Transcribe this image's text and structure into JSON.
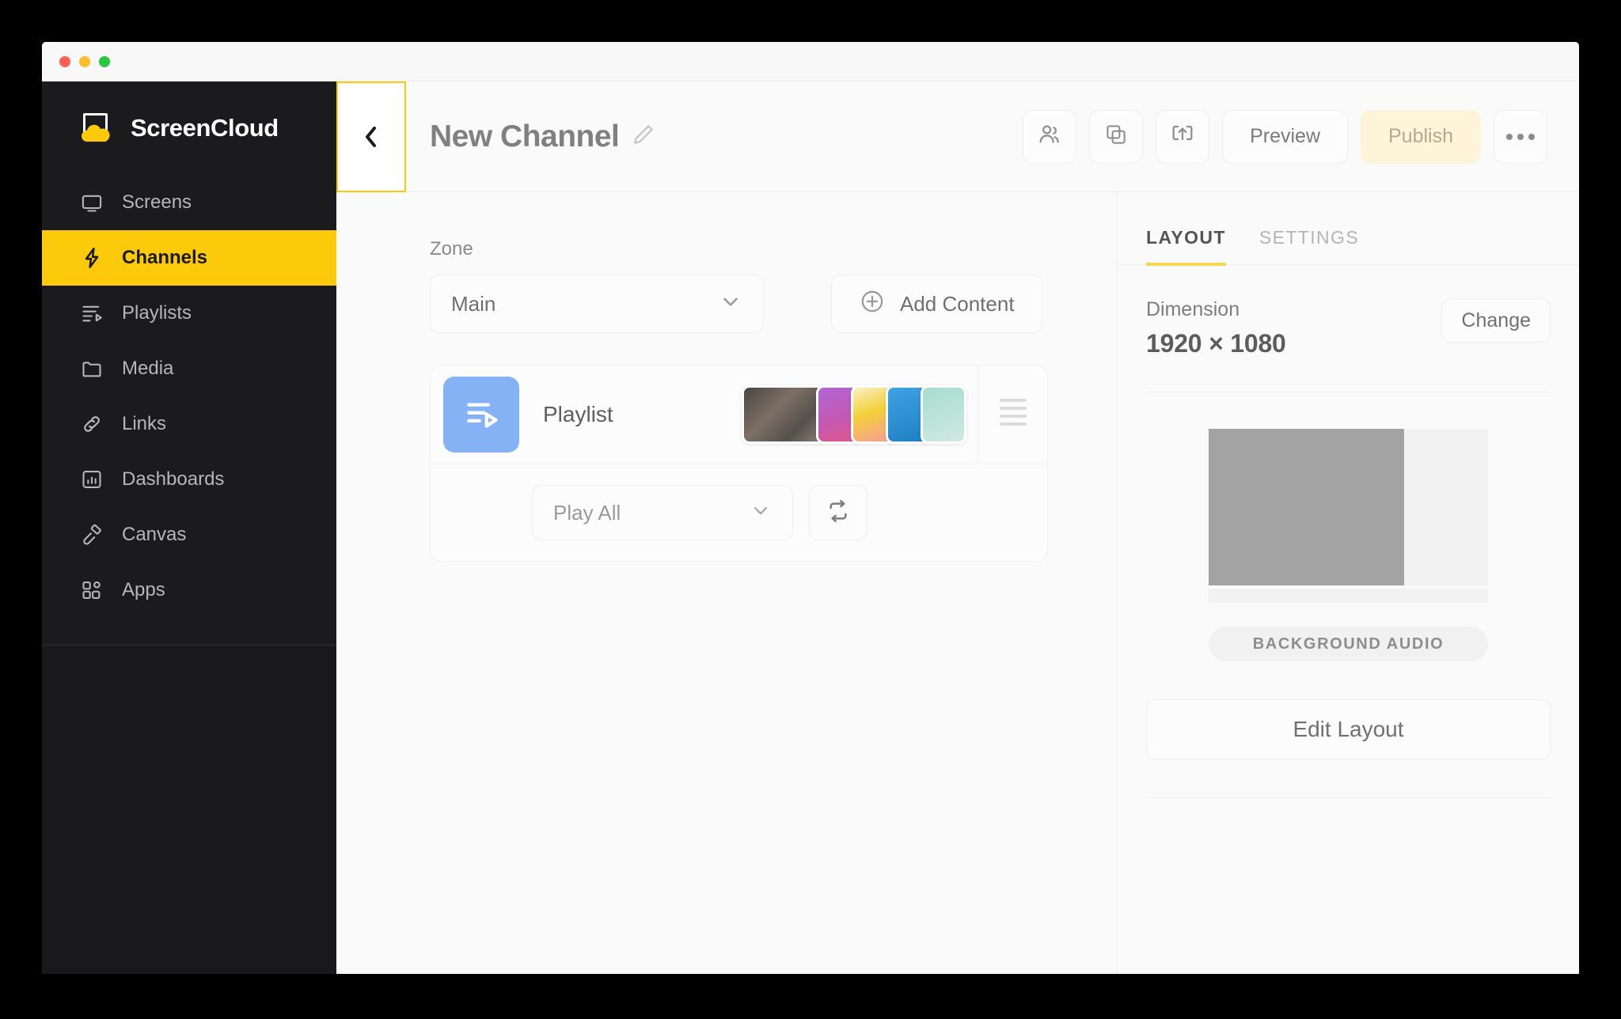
{
  "window": {
    "traffic_lights": [
      "close",
      "minimize",
      "maximize"
    ],
    "colors": {
      "close": "#ff5f57",
      "minimize": "#febc2e",
      "maximize": "#28c840"
    }
  },
  "brand": {
    "name": "ScreenCloud",
    "logo_icon": "screencloud-logo-icon"
  },
  "sidebar": {
    "items": [
      {
        "label": "Screens",
        "icon": "monitor-icon",
        "active": false
      },
      {
        "label": "Channels",
        "icon": "lightning-icon",
        "active": true
      },
      {
        "label": "Playlists",
        "icon": "playlist-icon",
        "active": false
      },
      {
        "label": "Media",
        "icon": "folder-icon",
        "active": false
      },
      {
        "label": "Links",
        "icon": "link-icon",
        "active": false
      },
      {
        "label": "Dashboards",
        "icon": "chart-icon",
        "active": false
      },
      {
        "label": "Canvas",
        "icon": "brush-icon",
        "active": false
      },
      {
        "label": "Apps",
        "icon": "apps-icon",
        "active": false
      }
    ],
    "accent_color": "#fcc90b",
    "background_color": "#1b1b1e"
  },
  "header": {
    "collapse_icon": "chevron-left-icon",
    "title": "New Channel",
    "edit_icon": "pencil-icon",
    "actions": [
      {
        "name": "share-users-button",
        "icon": "users-icon"
      },
      {
        "name": "duplicate-button",
        "icon": "copy-icon"
      },
      {
        "name": "cast-button",
        "icon": "cast-upload-icon"
      }
    ],
    "preview_label": "Preview",
    "publish_label": "Publish",
    "publish_bg": "#fdf4d9",
    "more_icon": "ellipsis-icon"
  },
  "editor": {
    "zone_label": "Zone",
    "zone_value": "Main",
    "zone_caret_icon": "chevron-down-icon",
    "add_content_label": "Add Content",
    "add_content_icon": "plus-circle-icon",
    "playlist": {
      "icon": "playlist-icon",
      "icon_color": "#85b2f5",
      "label": "Playlist",
      "thumbnails": [
        {
          "name": "gym-class-photo",
          "colors": [
            "#3d3a38",
            "#8d7e70"
          ]
        },
        {
          "name": "purple-gradient",
          "colors": [
            "#b065d8",
            "#e0568a"
          ]
        },
        {
          "name": "yellow-swirl",
          "colors": [
            "#f3d03a",
            "#f79b9b"
          ]
        },
        {
          "name": "blue-cards",
          "colors": [
            "#2f96da",
            "#1f7fc4"
          ]
        },
        {
          "name": "mint-gradient",
          "colors": [
            "#a8dcd0",
            "#c9e8df"
          ]
        }
      ],
      "drag_handle_icon": "drag-handle-icon",
      "play_mode": "Play All",
      "play_mode_caret_icon": "chevron-down-icon",
      "repeat_icon": "repeat-icon"
    }
  },
  "panel": {
    "tabs": [
      {
        "label": "LAYOUT",
        "active": true
      },
      {
        "label": "SETTINGS",
        "active": false
      }
    ],
    "active_tab_color": "#f7d64f",
    "dimension_label": "Dimension",
    "dimension_value": "1920 × 1080",
    "change_label": "Change",
    "preview": {
      "main_zone_ratio": 70,
      "main_zone_color": "#a3a3a3"
    },
    "background_audio_label": "BACKGROUND AUDIO",
    "edit_layout_label": "Edit Layout"
  }
}
